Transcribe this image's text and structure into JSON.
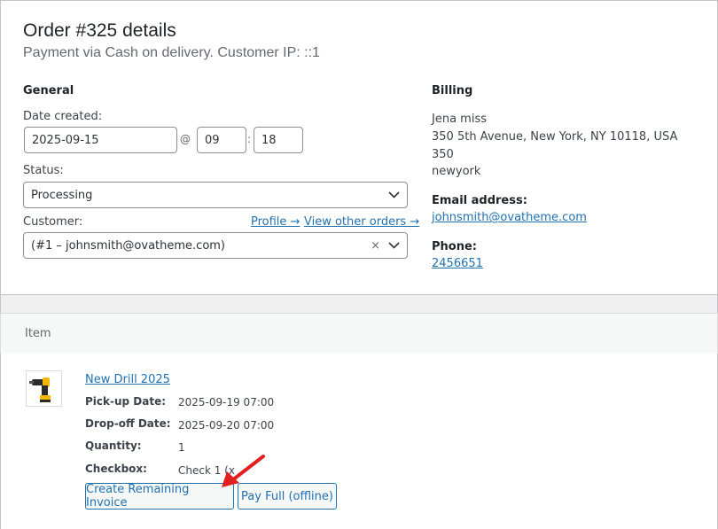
{
  "order": {
    "title": "Order #325 details",
    "subtitle": "Payment via Cash on delivery. Customer IP: ::1"
  },
  "general": {
    "heading": "General",
    "date_label": "Date created:",
    "date_value": "2025-09-15",
    "at_symbol": "@",
    "hour_value": "09",
    "colon": ":",
    "minute_value": "18",
    "status_label": "Status:",
    "status_value": "Processing",
    "customer_label": "Customer:",
    "profile_link": "Profile →",
    "view_orders_link": "View other orders →",
    "customer_value": "(#1 – johnsmith@ovatheme.com)",
    "clear_symbol": "×"
  },
  "billing": {
    "heading": "Billing",
    "address_lines": [
      "Jena miss",
      "350 5th Avenue, New York, NY 10118, USA",
      "350",
      "newyork"
    ],
    "email_label": "Email address:",
    "email_value": "johnsmith@ovatheme.com",
    "phone_label": "Phone:",
    "phone_value": "2456651"
  },
  "items": {
    "header": "Item",
    "product_name": "New Drill 2025",
    "meta": [
      {
        "key": "Pick-up Date:",
        "value": "2025-09-19 07:00"
      },
      {
        "key": "Drop-off Date:",
        "value": "2025-09-20 07:00"
      },
      {
        "key": "Quantity:",
        "value": "1"
      },
      {
        "key": "Checkbox:",
        "value": "Check 1 (x"
      }
    ],
    "create_invoice_button": "Create Remaining Invoice",
    "pay_full_button": "Pay Full (offline)"
  },
  "colors": {
    "link": "#2271b1",
    "annotation_arrow": "#e02020"
  }
}
